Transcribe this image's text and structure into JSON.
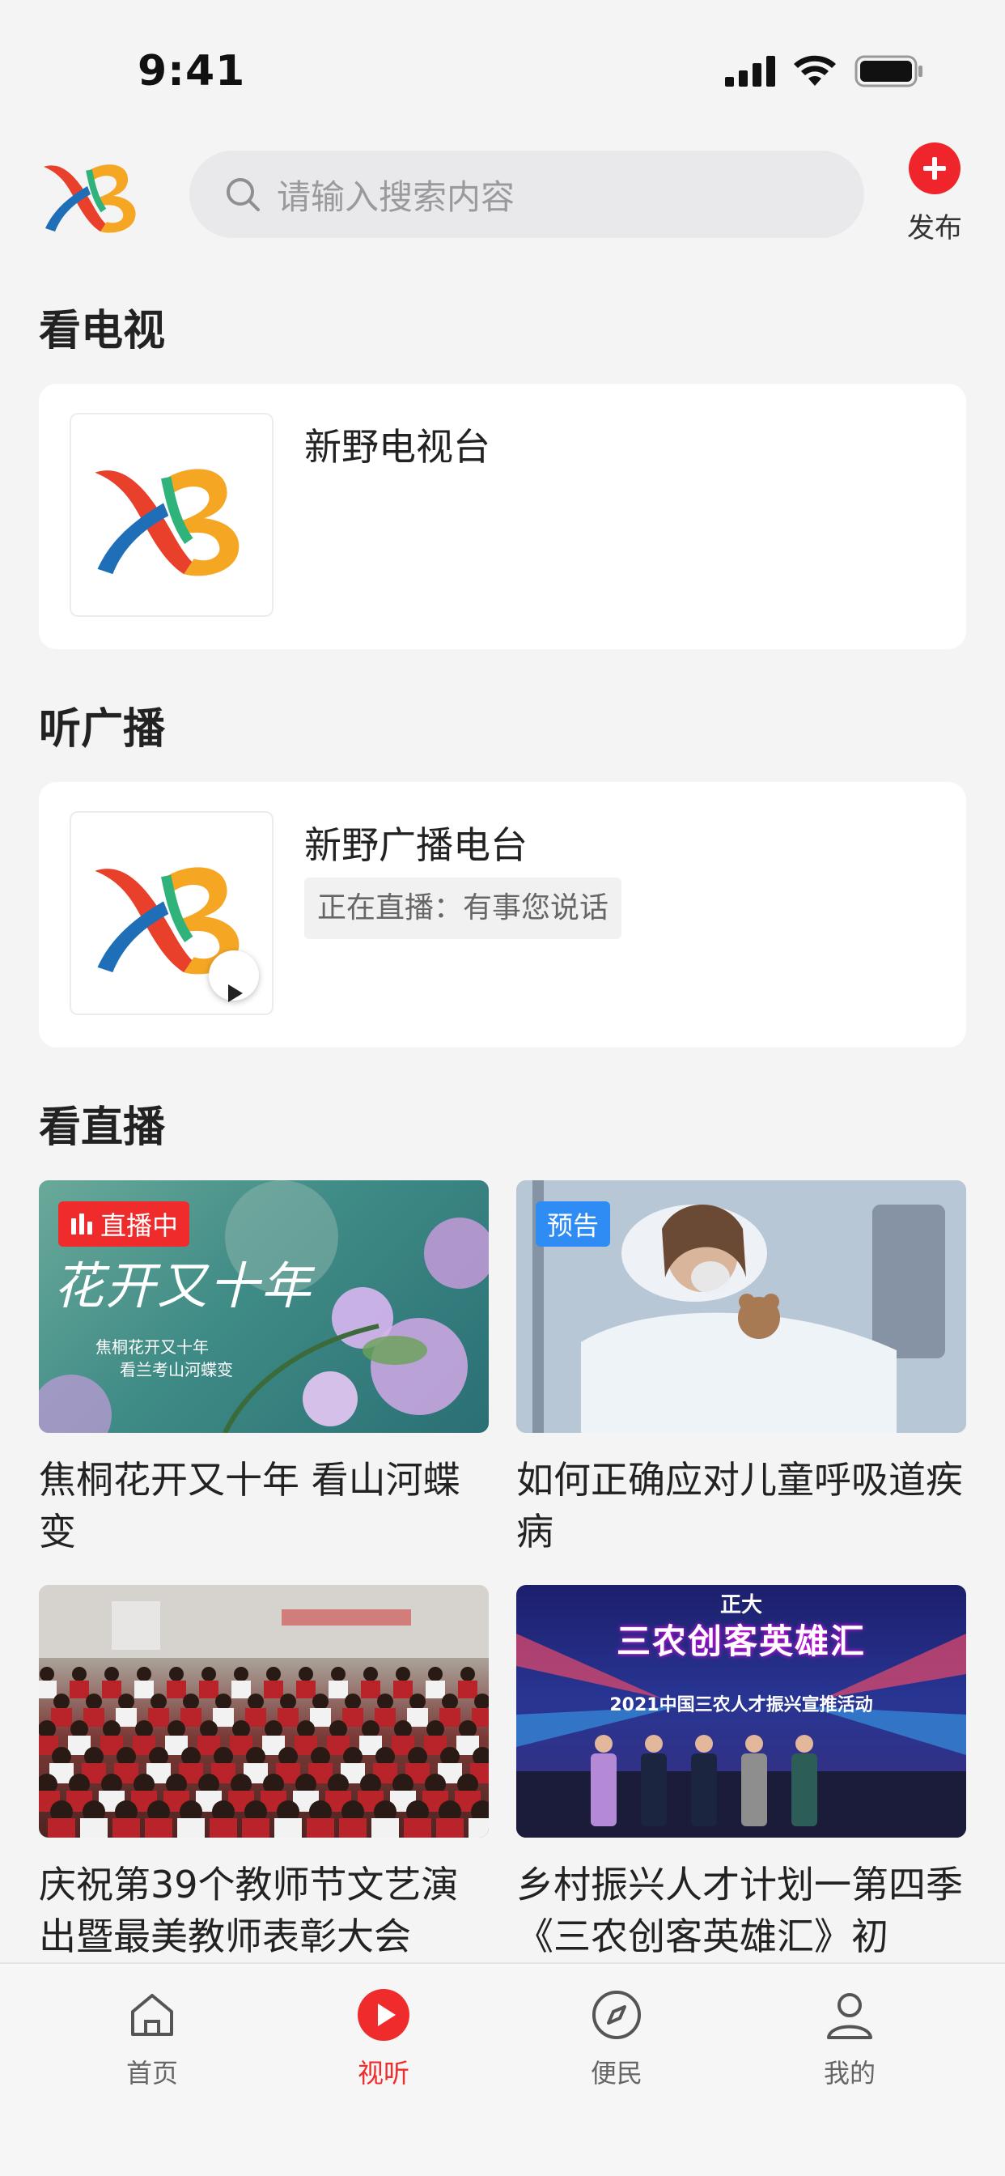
{
  "status_bar": {
    "time": "9:41"
  },
  "header": {
    "search_placeholder": "请输入搜索内容",
    "publish_label": "发布"
  },
  "tv_section": {
    "title": "看电视",
    "item": {
      "name": "新野电视台"
    }
  },
  "radio_section": {
    "title": "听广播",
    "item": {
      "name": "新野广播电台",
      "now_playing": "正在直播：有事您说话"
    }
  },
  "live_section": {
    "title": "看直播",
    "items": [
      {
        "caption": "焦桐花开又十年 看山河蝶变",
        "badge": "直播中",
        "img_text_big": "花开又十年",
        "img_text_small1": "焦桐花开又十年",
        "img_text_small2": "看兰考山河蝶变"
      },
      {
        "caption": "如何正确应对儿童呼吸道疾病",
        "badge": "预告"
      },
      {
        "caption": "庆祝第39个教师节文艺演出暨最美教师表彰大会"
      },
      {
        "caption": "乡村振兴人才计划一第四季《三农创客英雄汇》初",
        "img_text_top": "正大",
        "img_text_title": "三农创客英雄汇",
        "img_text_sub": "2021中国三农人才振兴宣推活动"
      }
    ]
  },
  "tabbar": {
    "tabs": [
      {
        "label": "首页",
        "icon": "home-icon"
      },
      {
        "label": "视听",
        "icon": "play-icon"
      },
      {
        "label": "便民",
        "icon": "compass-icon"
      },
      {
        "label": "我的",
        "icon": "user-icon"
      }
    ],
    "active_index": 1
  },
  "colors": {
    "accent_red": "#ef2b2b",
    "preview_blue": "#2f8cf5",
    "background": "#f4f4f5"
  }
}
